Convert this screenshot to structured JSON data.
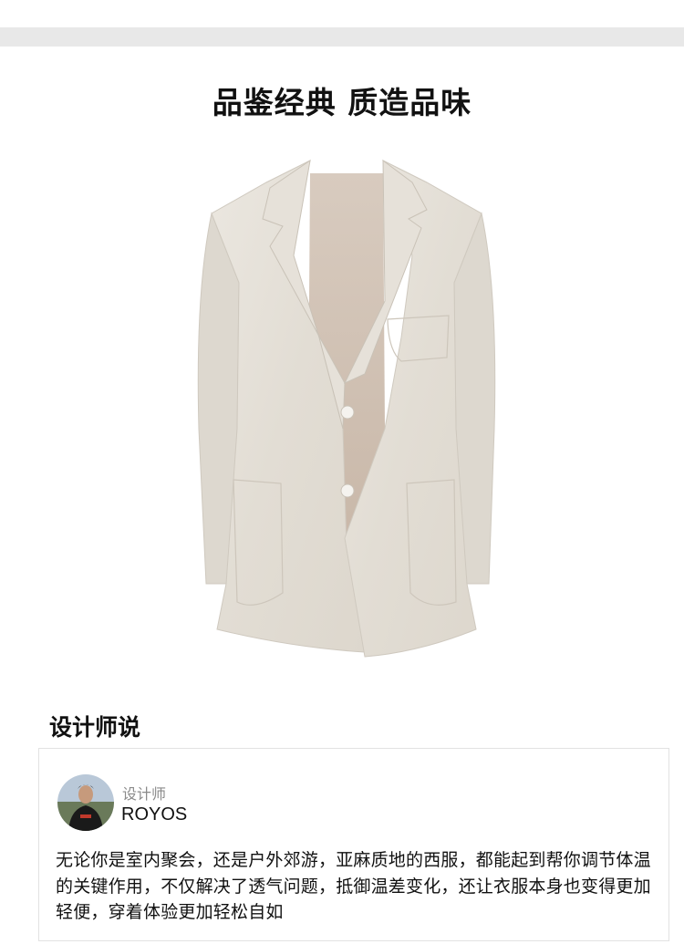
{
  "headline": "品鉴经典  质造品味",
  "product": {
    "image_name": "linen-blazer-image"
  },
  "designer_section": {
    "title": "设计师说",
    "role": "设计师",
    "name": "ROYOS",
    "quote": "无论你是室内聚会，还是户外郊游，亚麻质地的西服，都能起到帮你调节体温的关键作用，不仅解决了透气问题，抵御温差变化，还让衣服本身也变得更加轻便，穿着体验更加轻松自如"
  },
  "colors": {
    "background": "#ffffff",
    "top_bar": "#e8e8e8",
    "blazer": "#e4dfd7",
    "lining": "#d3c4b7",
    "card_border": "#e2e2e2",
    "muted_text": "#8a8a8a"
  }
}
